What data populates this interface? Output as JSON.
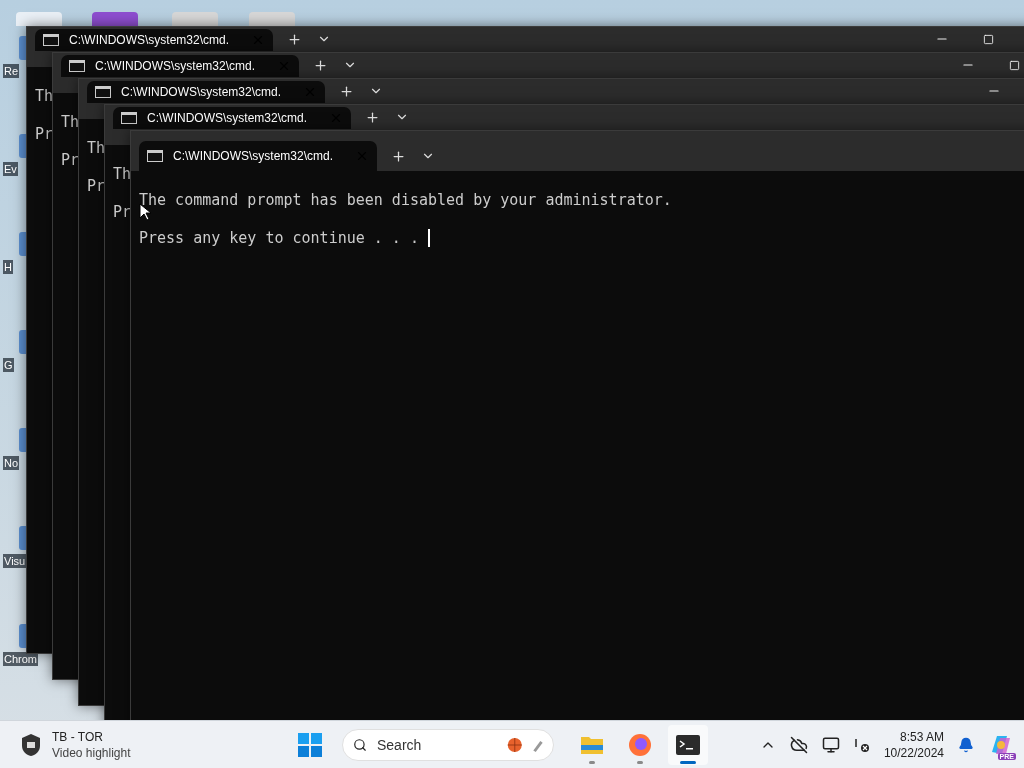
{
  "desktop": {
    "icons": [
      {
        "label": "Re"
      },
      {
        "label": "Ev"
      },
      {
        "label": "H"
      },
      {
        "label": "G"
      },
      {
        "label": "No"
      },
      {
        "label": "Visu"
      },
      {
        "label": "Chrom"
      }
    ]
  },
  "windows": [
    {
      "tab_title": "C:\\WINDOWS\\system32\\cmd.",
      "lines": [
        "Th",
        "Pr"
      ]
    },
    {
      "tab_title": "C:\\WINDOWS\\system32\\cmd.",
      "lines": [
        "Th",
        "Pr"
      ]
    },
    {
      "tab_title": "C:\\WINDOWS\\system32\\cmd.",
      "lines": [
        "Th",
        "Pr"
      ]
    },
    {
      "tab_title": "C:\\WINDOWS\\system32\\cmd.",
      "lines": [
        "Th",
        "Pr"
      ]
    },
    {
      "tab_title": "C:\\WINDOWS\\system32\\cmd.",
      "lines": [
        "The command prompt has been disabled by your administrator.",
        "Press any key to continue . . ."
      ]
    }
  ],
  "taskbar": {
    "widget": {
      "title": "TB - TOR",
      "subtitle": "Video highlight"
    },
    "search": {
      "placeholder": "Search"
    },
    "apps": [
      {
        "kind": "explorer",
        "selected": false
      },
      {
        "kind": "firefox",
        "selected": false
      },
      {
        "kind": "terminal",
        "selected": true
      }
    ],
    "clock": {
      "time": "8:53 AM",
      "date": "10/22/2024"
    },
    "copilot_badge": "PRE"
  }
}
